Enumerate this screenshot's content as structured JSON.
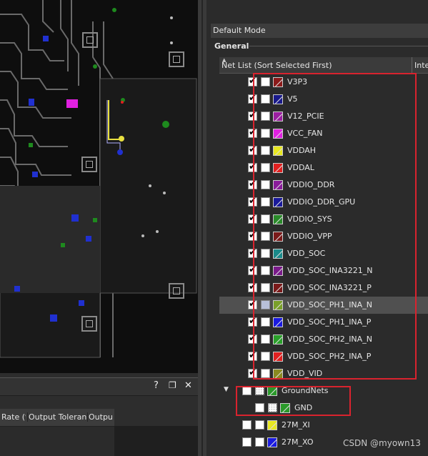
{
  "mode": {
    "title": "Default Mode",
    "section": "General"
  },
  "net_list": {
    "column_header": "Net List (Sort Selected First)",
    "second_column_header": "Inte",
    "items": [
      {
        "name": "V3P3",
        "checked": true,
        "color": "#8b1a1a"
      },
      {
        "name": "V5",
        "checked": true,
        "color": "#1a1a8b"
      },
      {
        "name": "V12_PCIE",
        "checked": true,
        "color": "#9b1fa0"
      },
      {
        "name": "VCC_FAN",
        "checked": true,
        "color": "#e020e0"
      },
      {
        "name": "VDDAH",
        "checked": true,
        "color": "#e8e820"
      },
      {
        "name": "VDDAL",
        "checked": true,
        "color": "#e02020"
      },
      {
        "name": "VDDIO_DDR",
        "checked": true,
        "color": "#8a1c9a"
      },
      {
        "name": "VDDIO_DDR_GPU",
        "checked": true,
        "color": "#1a1a9b"
      },
      {
        "name": "VDDIO_SYS",
        "checked": true,
        "color": "#2a8a2a"
      },
      {
        "name": "VDDIO_VPP",
        "checked": true,
        "color": "#7a1a1a"
      },
      {
        "name": "VDD_SOC",
        "checked": true,
        "color": "#1a8a8a"
      },
      {
        "name": "VDD_SOC_INA3221_N",
        "checked": true,
        "color": "#7a1a8a"
      },
      {
        "name": "VDD_SOC_INA3221_P",
        "checked": true,
        "color": "#7a1a1a"
      },
      {
        "name": "VDD_SOC_PH1_INA_N",
        "checked": true,
        "color": "#7aa02a",
        "selected": true
      },
      {
        "name": "VDD_SOC_PH1_INA_P",
        "checked": true,
        "color": "#1a1ae0"
      },
      {
        "name": "VDD_SOC_PH2_INA_N",
        "checked": true,
        "color": "#2aa02a"
      },
      {
        "name": "VDD_SOC_PH2_INA_P",
        "checked": true,
        "color": "#e02020"
      },
      {
        "name": "VDD_VID",
        "checked": true,
        "color": "#8a8a20"
      }
    ],
    "group": {
      "name": "GroundNets",
      "expanded": true,
      "color": "#2a9a2a",
      "children": [
        {
          "name": "GND",
          "color": "#2a9a2a"
        }
      ]
    },
    "tail_items": [
      {
        "name": "27M_XI",
        "color": "#e8e820"
      },
      {
        "name": "27M_XO",
        "color": "#1a1ae0"
      }
    ]
  },
  "bottom_panel": {
    "buttons": {
      "help": "?",
      "restore": "❐",
      "close": "✕"
    },
    "columns": [
      "Rate (%",
      "Output Toleranc",
      "Outpu"
    ]
  },
  "watermark": "CSDN @myown13"
}
